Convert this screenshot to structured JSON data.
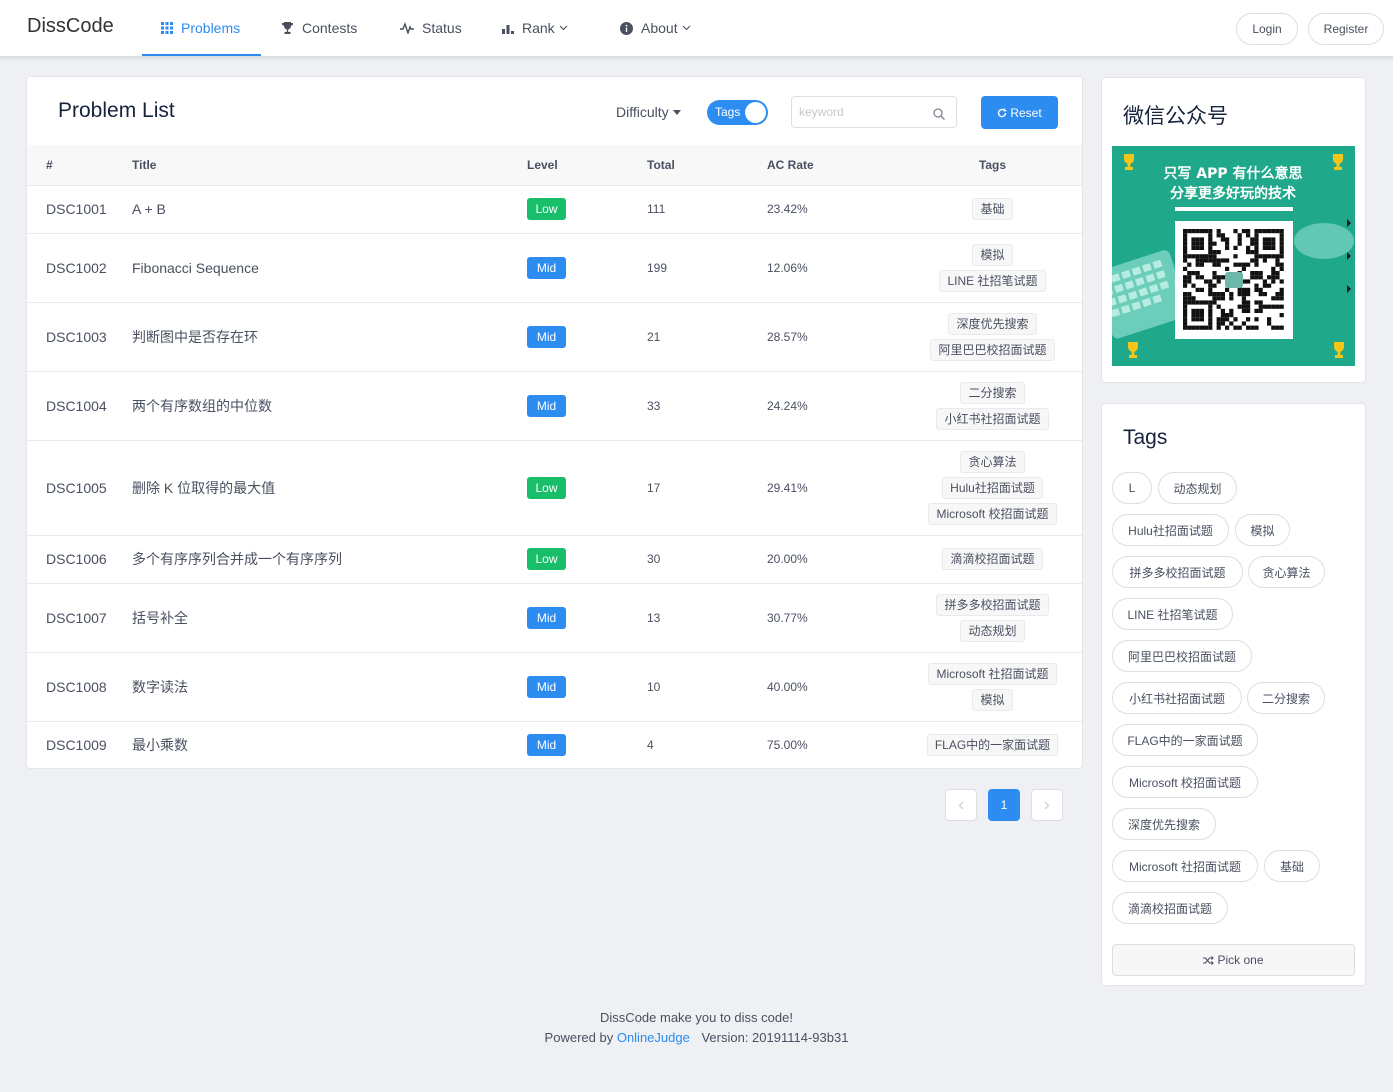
{
  "header": {
    "logo": "DissCode",
    "nav": [
      {
        "label": "Problems",
        "icon": "grid-icon",
        "active": true
      },
      {
        "label": "Contests",
        "icon": "trophy-icon"
      },
      {
        "label": "Status",
        "icon": "pulse-icon"
      },
      {
        "label": "Rank",
        "icon": "bar-chart-icon",
        "dropdown": true
      },
      {
        "label": "About",
        "icon": "info-icon",
        "dropdown": true
      }
    ],
    "login": "Login",
    "register": "Register"
  },
  "problems": {
    "title": "Problem List",
    "difficulty_label": "Difficulty",
    "tags_switch_label": "Tags",
    "tags_switch_on": true,
    "search_placeholder": "keyword",
    "search_value": "",
    "reset_label": "Reset",
    "columns": [
      "#",
      "Title",
      "Level",
      "Total",
      "AC Rate",
      "Tags"
    ],
    "rows": [
      {
        "id": "DSC1001",
        "title": "A + B",
        "level": "Low",
        "total": "111",
        "ac_rate": "23.42%",
        "tags": [
          "基础"
        ]
      },
      {
        "id": "DSC1002",
        "title": "Fibonacci Sequence",
        "level": "Mid",
        "total": "199",
        "ac_rate": "12.06%",
        "tags": [
          "模拟",
          "LINE 社招笔试题"
        ]
      },
      {
        "id": "DSC1003",
        "title": "判断图中是否存在环",
        "level": "Mid",
        "total": "21",
        "ac_rate": "28.57%",
        "tags": [
          "深度优先搜索",
          "阿里巴巴校招面试题"
        ]
      },
      {
        "id": "DSC1004",
        "title": "两个有序数组的中位数",
        "level": "Mid",
        "total": "33",
        "ac_rate": "24.24%",
        "tags": [
          "二分搜索",
          "小红书社招面试题"
        ]
      },
      {
        "id": "DSC1005",
        "title": "删除 K 位取得的最大值",
        "level": "Low",
        "total": "17",
        "ac_rate": "29.41%",
        "tags": [
          "贪心算法",
          "Hulu社招面试题",
          "Microsoft 校招面试题"
        ]
      },
      {
        "id": "DSC1006",
        "title": "多个有序序列合并成一个有序序列",
        "level": "Low",
        "total": "30",
        "ac_rate": "20.00%",
        "tags": [
          "滴滴校招面试题"
        ]
      },
      {
        "id": "DSC1007",
        "title": "括号补全",
        "level": "Mid",
        "total": "13",
        "ac_rate": "30.77%",
        "tags": [
          "拼多多校招面试题",
          "动态规划"
        ]
      },
      {
        "id": "DSC1008",
        "title": "数字读法",
        "level": "Mid",
        "total": "10",
        "ac_rate": "40.00%",
        "tags": [
          "Microsoft 社招面试题",
          "模拟"
        ]
      },
      {
        "id": "DSC1009",
        "title": "最小乘数",
        "level": "Mid",
        "total": "4",
        "ac_rate": "75.00%",
        "tags": [
          "FLAG中的一家面试题"
        ]
      }
    ],
    "pagination": {
      "current": "1"
    }
  },
  "wechat": {
    "title": "微信公众号",
    "banner_line1": "只写 APP 有什么意思",
    "banner_line2": "分享更多好玩的技术",
    "colors": {
      "banner": "#1fa88a",
      "accent": "#f5c518"
    }
  },
  "tags_panel": {
    "title": "Tags",
    "tags": [
      "L",
      "动态规划",
      "Hulu社招面试题",
      "模拟",
      "拼多多校招面试题",
      "贪心算法",
      "LINE 社招笔试题",
      "阿里巴巴校招面试题",
      "小红书社招面试题",
      "二分搜索",
      "FLAG中的一家面试题",
      "Microsoft 校招面试题",
      "深度优先搜索",
      "Microsoft 社招面试题",
      "基础",
      "滴滴校招面试题"
    ],
    "pick_one": "Pick one"
  },
  "footer": {
    "line1": "DissCode make you to diss code!",
    "powered_by": "Powered by",
    "oj_link": "OnlineJudge",
    "version": "Version: 20191114-93b31"
  },
  "colors": {
    "primary": "#2d8cf0",
    "low": "#19be6b",
    "mid": "#2d8cf0"
  }
}
